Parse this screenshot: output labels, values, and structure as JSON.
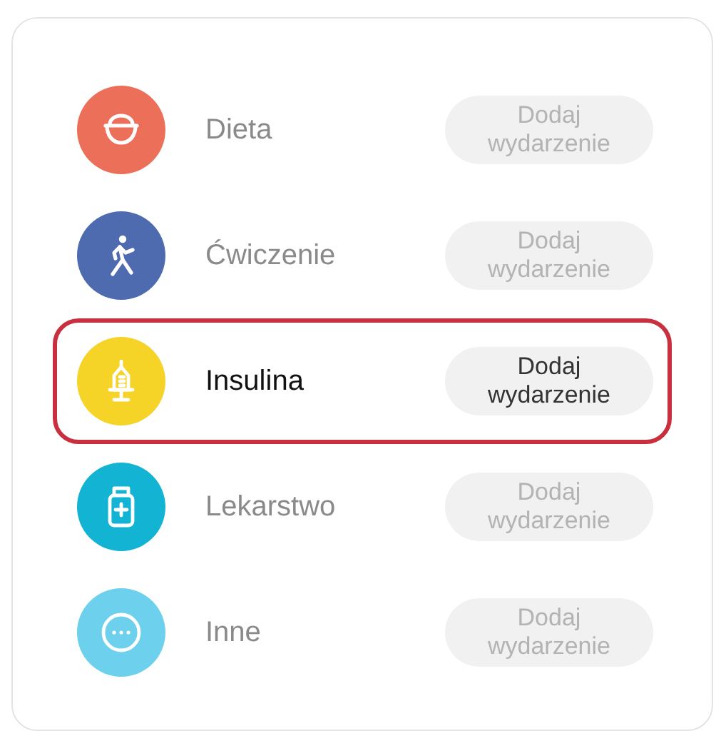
{
  "events": [
    {
      "kind": "bowl",
      "label": "Dieta",
      "color": "#ec6f5a",
      "selected": false,
      "button": "Dodaj wydarzenie"
    },
    {
      "kind": "walker",
      "label": "Ćwiczenie",
      "color": "#4f6bb0",
      "selected": false,
      "button": "Dodaj wydarzenie"
    },
    {
      "kind": "syringe",
      "label": "Insulina",
      "color": "#f5d327",
      "selected": true,
      "button": "Dodaj wydarzenie"
    },
    {
      "kind": "bottle",
      "label": "Lekarstwo",
      "color": "#12b3d3",
      "selected": false,
      "button": "Dodaj wydarzenie"
    },
    {
      "kind": "dots",
      "label": "Inne",
      "color": "#6dd0ec",
      "selected": false,
      "button": "Dodaj wydarzenie"
    }
  ]
}
